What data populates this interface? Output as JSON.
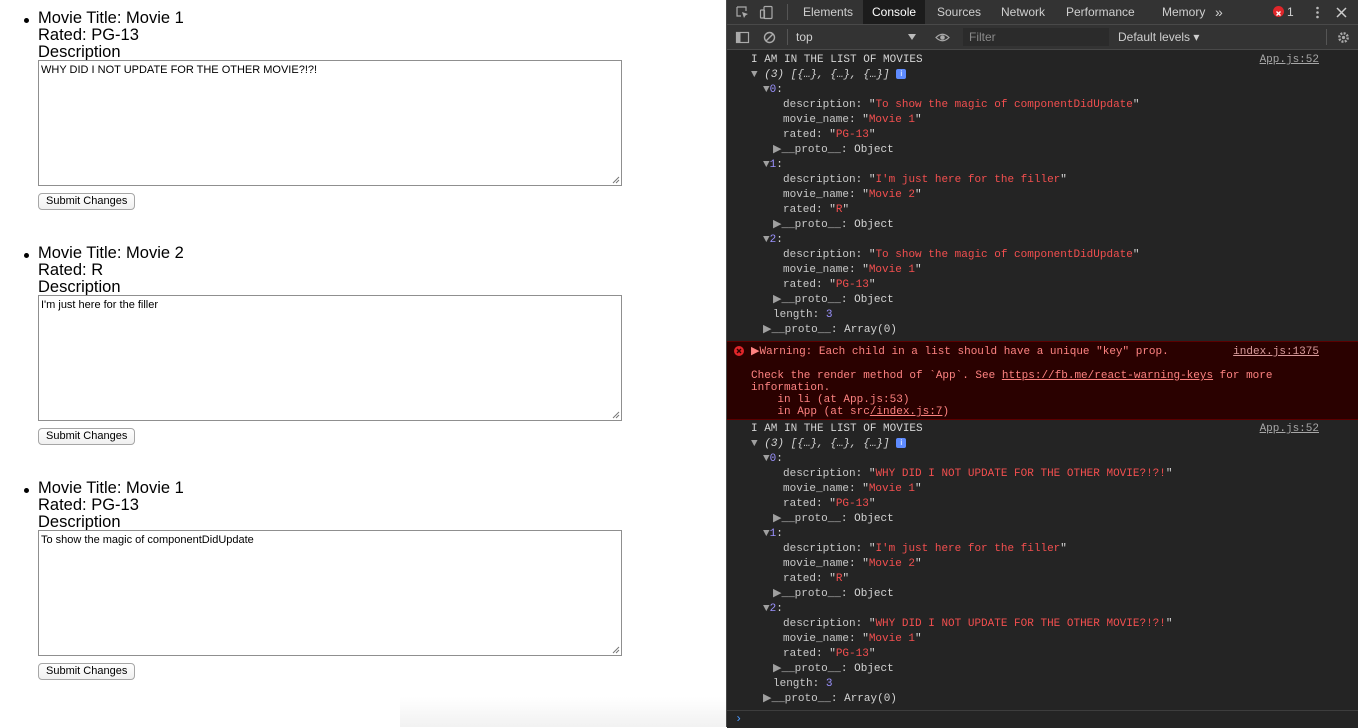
{
  "page": {
    "movies": [
      {
        "title_line": "Movie Title: Movie 1",
        "rated_line": "Rated: PG-13",
        "desc_label": "Description",
        "textarea_value": "WHY DID I NOT UPDATE FOR THE OTHER MOVIE?!?!",
        "submit_label": "Submit Changes"
      },
      {
        "title_line": "Movie Title: Movie 2",
        "rated_line": "Rated: R",
        "desc_label": "Description",
        "textarea_value": "I'm just here for the filler",
        "submit_label": "Submit Changes"
      },
      {
        "title_line": "Movie Title: Movie 1",
        "rated_line": "Rated: PG-13",
        "desc_label": "Description",
        "textarea_value": "To show the magic of componentDidUpdate",
        "submit_label": "Submit Changes"
      }
    ]
  },
  "devtools": {
    "tabs": [
      "Elements",
      "Console",
      "Sources",
      "Network",
      "Performance",
      "Memory"
    ],
    "active_tab": "Console",
    "more_tabs": "»",
    "error_count": "1",
    "context": "top",
    "filter_placeholder": "Filter",
    "levels": "Default levels ▾",
    "log1": {
      "message": "I AM IN THE LIST OF MOVIES",
      "source": "App.js:52",
      "summary": "(3) [{…}, {…}, {…}]",
      "items": [
        {
          "index": "0",
          "description": "To show the magic of componentDidUpdate",
          "movie_name": "Movie 1",
          "rated": "PG-13"
        },
        {
          "index": "1",
          "description": "I'm just here for the filler",
          "movie_name": "Movie 2",
          "rated": "R"
        },
        {
          "index": "2",
          "description": "To show the magic of componentDidUpdate",
          "movie_name": "Movie 1",
          "rated": "PG-13"
        }
      ],
      "length": "3"
    },
    "warning": {
      "message": "Warning: Each child in a list should have a unique \"key\" prop.",
      "source": "index.js:1375",
      "line2_pre": "Check the render method of `App`. See ",
      "line2_link": "https://fb.me/react-warning-keys",
      "line2_post": " for more",
      "line3": "information.",
      "line4": "    in li (at App.js:53)",
      "line5_pre": "    in App (at src",
      "line5_link": "/index.js:7",
      "line5_post": ")"
    },
    "log2": {
      "message": "I AM IN THE LIST OF MOVIES",
      "source": "App.js:52",
      "summary": "(3) [{…}, {…}, {…}]",
      "items": [
        {
          "index": "0",
          "description": "WHY DID I NOT UPDATE FOR THE OTHER MOVIE?!?!",
          "movie_name": "Movie 1",
          "rated": "PG-13"
        },
        {
          "index": "1",
          "description": "I'm just here for the filler",
          "movie_name": "Movie 2",
          "rated": "R"
        },
        {
          "index": "2",
          "description": "WHY DID I NOT UPDATE FOR THE OTHER MOVIE?!?!",
          "movie_name": "Movie 1",
          "rated": "PG-13"
        }
      ],
      "length": "3"
    },
    "labels": {
      "description": "description",
      "movie_name": "movie_name",
      "rated": "rated",
      "proto": "__proto__",
      "object": "Object",
      "array": "Array(0)",
      "length": "length"
    },
    "prompt": "›"
  }
}
